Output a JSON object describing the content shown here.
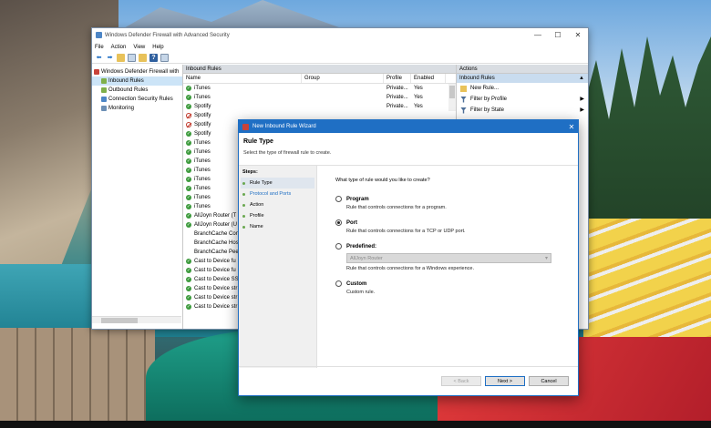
{
  "mmc": {
    "title": "Windows Defender Firewall with Advanced Security",
    "controls": {
      "minimize": "—",
      "maximize": "☐",
      "close": "✕"
    },
    "menu": [
      "File",
      "Action",
      "View",
      "Help"
    ],
    "tree": {
      "root": "Windows Defender Firewall with",
      "items": [
        "Inbound Rules",
        "Outbound Rules",
        "Connection Security Rules",
        "Monitoring"
      ]
    },
    "list": {
      "header": "Inbound Rules",
      "columns": {
        "name": "Name",
        "group": "Group",
        "profile": "Profile",
        "enabled": "Enabled"
      },
      "rows": [
        {
          "name": "iTunes",
          "profile": "Private...",
          "enabled": "Yes",
          "status": "allow"
        },
        {
          "name": "iTunes",
          "profile": "Private...",
          "enabled": "Yes",
          "status": "allow"
        },
        {
          "name": "Spotify",
          "profile": "Private...",
          "enabled": "Yes",
          "status": "allow"
        },
        {
          "name": "Spotify",
          "profile": "",
          "enabled": "",
          "status": "block"
        },
        {
          "name": "Spotify",
          "profile": "",
          "enabled": "",
          "status": "block"
        },
        {
          "name": "Spotify",
          "profile": "",
          "enabled": "",
          "status": "allow"
        },
        {
          "name": "iTunes",
          "profile": "",
          "enabled": "",
          "status": "allow"
        },
        {
          "name": "iTunes",
          "profile": "",
          "enabled": "",
          "status": "allow"
        },
        {
          "name": "iTunes",
          "profile": "",
          "enabled": "",
          "status": "allow"
        },
        {
          "name": "iTunes",
          "profile": "",
          "enabled": "",
          "status": "allow"
        },
        {
          "name": "iTunes",
          "profile": "",
          "enabled": "",
          "status": "allow"
        },
        {
          "name": "iTunes",
          "profile": "",
          "enabled": "",
          "status": "allow"
        },
        {
          "name": "iTunes",
          "profile": "",
          "enabled": "",
          "status": "allow"
        },
        {
          "name": "iTunes",
          "profile": "",
          "enabled": "",
          "status": "allow"
        },
        {
          "name": "AllJoyn Router (T",
          "profile": "",
          "enabled": "",
          "status": "allow"
        },
        {
          "name": "AllJoyn Router (U",
          "profile": "",
          "enabled": "",
          "status": "allow"
        },
        {
          "name": "BranchCache Con",
          "profile": "",
          "enabled": "",
          "status": "none"
        },
        {
          "name": "BranchCache Hos",
          "profile": "",
          "enabled": "",
          "status": "none"
        },
        {
          "name": "BranchCache Pee",
          "profile": "",
          "enabled": "",
          "status": "none"
        },
        {
          "name": "Cast to Device fu",
          "profile": "",
          "enabled": "",
          "status": "allow"
        },
        {
          "name": "Cast to Device fu",
          "profile": "",
          "enabled": "",
          "status": "allow"
        },
        {
          "name": "Cast to Device SS",
          "profile": "",
          "enabled": "",
          "status": "allow"
        },
        {
          "name": "Cast to Device str",
          "profile": "",
          "enabled": "",
          "status": "allow"
        },
        {
          "name": "Cast to Device str",
          "profile": "",
          "enabled": "",
          "status": "allow"
        },
        {
          "name": "Cast to Device str",
          "profile": "",
          "enabled": "",
          "status": "allow"
        }
      ]
    },
    "actions": {
      "header": "Actions",
      "section": "Inbound Rules",
      "items": [
        {
          "label": "New Rule...",
          "icon": "new-rule-icon",
          "arrow": ""
        },
        {
          "label": "Filter by Profile",
          "icon": "filter-icon",
          "arrow": "▶"
        },
        {
          "label": "Filter by State",
          "icon": "filter-icon",
          "arrow": "▶"
        }
      ]
    }
  },
  "wizard": {
    "title": "New Inbound Rule Wizard",
    "close": "✕",
    "heading": "Rule Type",
    "subheading": "Select the type of firewall rule to create.",
    "steps_title": "Steps:",
    "steps": [
      "Rule Type",
      "Protocol and Ports",
      "Action",
      "Profile",
      "Name"
    ],
    "question": "What type of rule would you like to create?",
    "options": [
      {
        "label": "Program",
        "desc": "Rule that controls connections for a program.",
        "checked": false
      },
      {
        "label": "Port",
        "desc": "Rule that controls connections for a TCP or UDP port.",
        "checked": true
      },
      {
        "label": "Predefined:",
        "desc": "Rule that controls connections for a Windows experience.",
        "checked": false
      },
      {
        "label": "Custom",
        "desc": "Custom rule.",
        "checked": false
      }
    ],
    "predefined_value": "AllJoyn Router",
    "buttons": {
      "back": "< Back",
      "next": "Next >",
      "cancel": "Cancel"
    }
  },
  "colors": {
    "accent": "#1f6fc4",
    "allow": "#3c9a3c",
    "block": "#c0392b"
  }
}
